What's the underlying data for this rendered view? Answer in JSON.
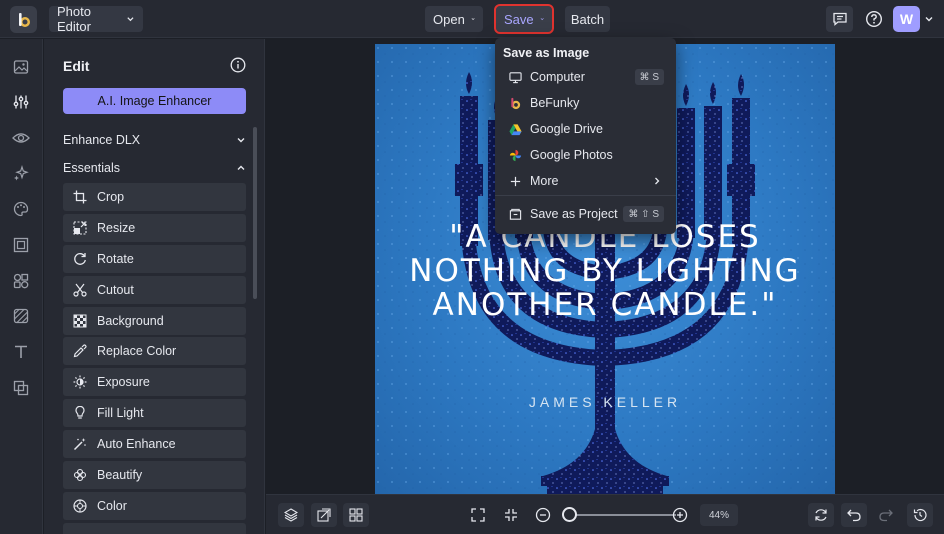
{
  "topbar": {
    "app_menu_label": "Photo Editor",
    "open_label": "Open",
    "save_label": "Save",
    "batch_label": "Batch",
    "avatar_initial": "W"
  },
  "panel": {
    "title": "Edit",
    "ai_button_label": "A.I. Image Enhancer",
    "sections": [
      {
        "label": "Enhance DLX",
        "expanded": false
      },
      {
        "label": "Essentials",
        "expanded": true
      }
    ],
    "tools": [
      {
        "label": "Crop",
        "icon": "crop-icon"
      },
      {
        "label": "Resize",
        "icon": "resize-icon"
      },
      {
        "label": "Rotate",
        "icon": "rotate-icon"
      },
      {
        "label": "Cutout",
        "icon": "cutout-icon"
      },
      {
        "label": "Background",
        "icon": "background-icon"
      },
      {
        "label": "Replace Color",
        "icon": "eyedropper-icon"
      },
      {
        "label": "Exposure",
        "icon": "exposure-icon"
      },
      {
        "label": "Fill Light",
        "icon": "lightbulb-icon"
      },
      {
        "label": "Auto Enhance",
        "icon": "magic-wand-icon"
      },
      {
        "label": "Beautify",
        "icon": "beautify-icon"
      },
      {
        "label": "Color",
        "icon": "color-wheel-icon"
      }
    ]
  },
  "save_menu": {
    "heading": "Save as Image",
    "items": [
      {
        "label": "Computer",
        "icon": "monitor-icon",
        "shortcut": "⌘ S"
      },
      {
        "label": "BeFunky",
        "icon": "befunky-logo-icon",
        "shortcut": ""
      },
      {
        "label": "Google Drive",
        "icon": "google-drive-icon",
        "shortcut": ""
      },
      {
        "label": "Google Photos",
        "icon": "google-photos-icon",
        "shortcut": ""
      },
      {
        "label": "More",
        "icon": "plus-icon",
        "shortcut": ""
      }
    ],
    "project_item": {
      "label": "Save as Project",
      "icon": "project-icon",
      "shortcut": "⌘ ⇧ S"
    }
  },
  "artwork": {
    "quote_lines": [
      "\"A CANDLE LOSES",
      "NOTHING BY LIGHTING",
      "ANOTHER CANDLE.\""
    ],
    "author": "JAMES KELLER"
  },
  "bottombar": {
    "zoom_level": "44%"
  },
  "colors": {
    "accent": "#8d8bf7",
    "highlight_outline": "#e0332f",
    "background": "#1c1f26",
    "panel": "#262932"
  }
}
